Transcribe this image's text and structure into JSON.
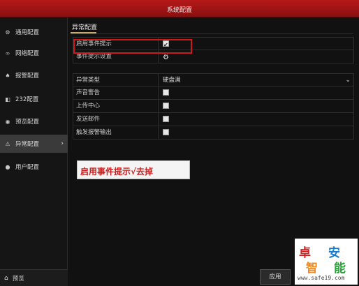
{
  "window": {
    "title": "系统配置"
  },
  "sidebar": {
    "items": [
      {
        "label": "通用配置",
        "icon": "gear-icon"
      },
      {
        "label": "网络配置",
        "icon": "network-icon"
      },
      {
        "label": "报警配置",
        "icon": "alarm-icon"
      },
      {
        "label": "232配置",
        "icon": "serial-icon"
      },
      {
        "label": "预览配置",
        "icon": "eye-icon"
      },
      {
        "label": "异常配置",
        "icon": "warning-icon",
        "active": true
      },
      {
        "label": "用户配置",
        "icon": "user-icon"
      }
    ],
    "bottom_label": "预览"
  },
  "main": {
    "tab_label": "异常配置",
    "rows_top": [
      {
        "label": "启用事件提示",
        "control": "checkbox",
        "checked": true
      },
      {
        "label": "事件提示设置",
        "control": "gear"
      }
    ],
    "rows_bottom": [
      {
        "label": "异常类型",
        "control": "select",
        "value": "硬盘满"
      },
      {
        "label": "声音警告",
        "control": "checkbox",
        "checked": false
      },
      {
        "label": "上传中心",
        "control": "checkbox",
        "checked": false
      },
      {
        "label": "发送邮件",
        "control": "checkbox",
        "checked": false
      },
      {
        "label": "触发报警输出",
        "control": "checkbox",
        "checked": false
      }
    ],
    "annotation": "启用事件提示√去掉"
  },
  "footer": {
    "apply_label": "应用"
  },
  "watermark": {
    "chars": [
      "卓",
      "安",
      "智",
      "能"
    ],
    "url": "www.safe19.com"
  },
  "colors": {
    "title_bar": "#a01414",
    "highlight": "#d01818",
    "tab_underline": "#c9a96a"
  }
}
